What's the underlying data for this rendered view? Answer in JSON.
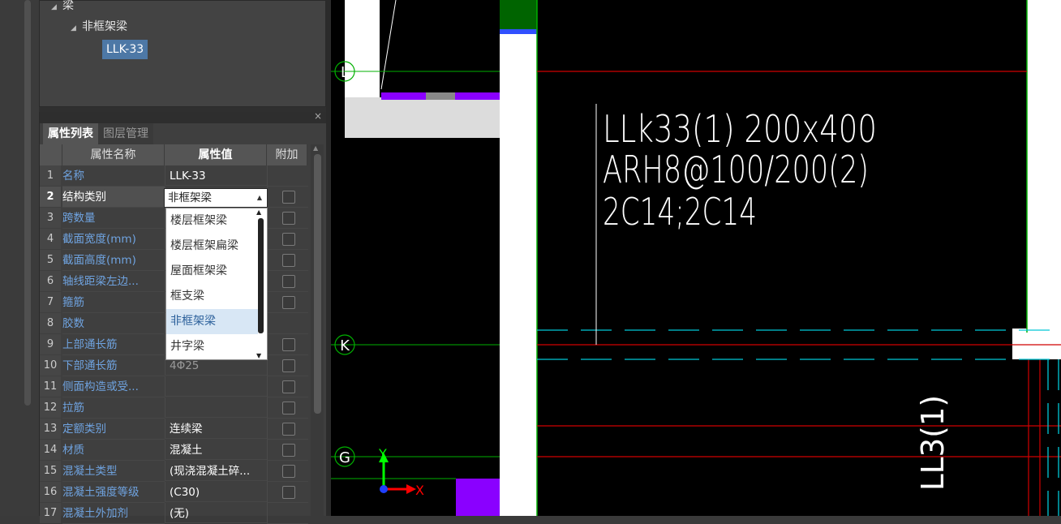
{
  "tree": {
    "root_label": "梁",
    "child_label": "非框架梁",
    "selected_item": "LLK-33"
  },
  "properties_panel": {
    "tabs": [
      "属性列表",
      "图层管理"
    ],
    "active_tab": "属性列表",
    "columns": [
      "属性名称",
      "属性值",
      "附加"
    ],
    "rows": [
      {
        "num": "1",
        "name": "名称",
        "value": "LLK-33",
        "has_check": false
      },
      {
        "num": "2",
        "name": "结构类别",
        "value": "非框架梁",
        "has_check": true
      },
      {
        "num": "3",
        "name": "跨数量",
        "value": "",
        "has_check": true
      },
      {
        "num": "4",
        "name": "截面宽度(mm)",
        "value": "",
        "has_check": true
      },
      {
        "num": "5",
        "name": "截面高度(mm)",
        "value": "",
        "has_check": true
      },
      {
        "num": "6",
        "name": "轴线距梁左边...",
        "value": "",
        "has_check": true
      },
      {
        "num": "7",
        "name": "箍筋",
        "value": "",
        "has_check": true
      },
      {
        "num": "8",
        "name": "胶数",
        "value": "",
        "has_check": false
      },
      {
        "num": "9",
        "name": "上部通长筋",
        "value": "",
        "has_check": true
      },
      {
        "num": "10",
        "name": "下部通长筋",
        "value": "4Φ25",
        "has_check": true
      },
      {
        "num": "11",
        "name": "侧面构造或受...",
        "value": "",
        "has_check": true
      },
      {
        "num": "12",
        "name": "拉筋",
        "value": "",
        "has_check": true
      },
      {
        "num": "13",
        "name": "定额类别",
        "value": "连续梁",
        "has_check": true
      },
      {
        "num": "14",
        "name": "材质",
        "value": "混凝土",
        "has_check": true
      },
      {
        "num": "15",
        "name": "混凝土类型",
        "value": "(现浇混凝土碎...",
        "has_check": true
      },
      {
        "num": "16",
        "name": "混凝土强度等级",
        "value": "(C30)",
        "has_check": true
      },
      {
        "num": "17",
        "name": "混凝土外加剂",
        "value": "(无)",
        "has_check": false
      }
    ],
    "selected_row": "2"
  },
  "dropdown": {
    "current_value": "非框架梁",
    "options": [
      "楼层框架梁",
      "楼层框架扁梁",
      "屋面框架梁",
      "框支梁",
      "非框架梁",
      "井字梁"
    ],
    "highlighted": "非框架梁"
  },
  "canvas": {
    "annotation_lines": [
      "LLk33(1) 200x400",
      "ARH8@100/200(2)",
      "2C14;2C14"
    ],
    "vertical_label": "LL3(1)",
    "axis_labels": [
      "L",
      "K",
      "G"
    ],
    "ucs": {
      "y": "Y",
      "x": "X"
    },
    "colors": {
      "background": "#000000",
      "wall": "#ffffff",
      "green_line": "#00b000",
      "red_line": "#d00000",
      "cyan_dash": "#00c8d8",
      "purple": "#8a00ff",
      "accent_blue": "#4d78a6"
    }
  }
}
